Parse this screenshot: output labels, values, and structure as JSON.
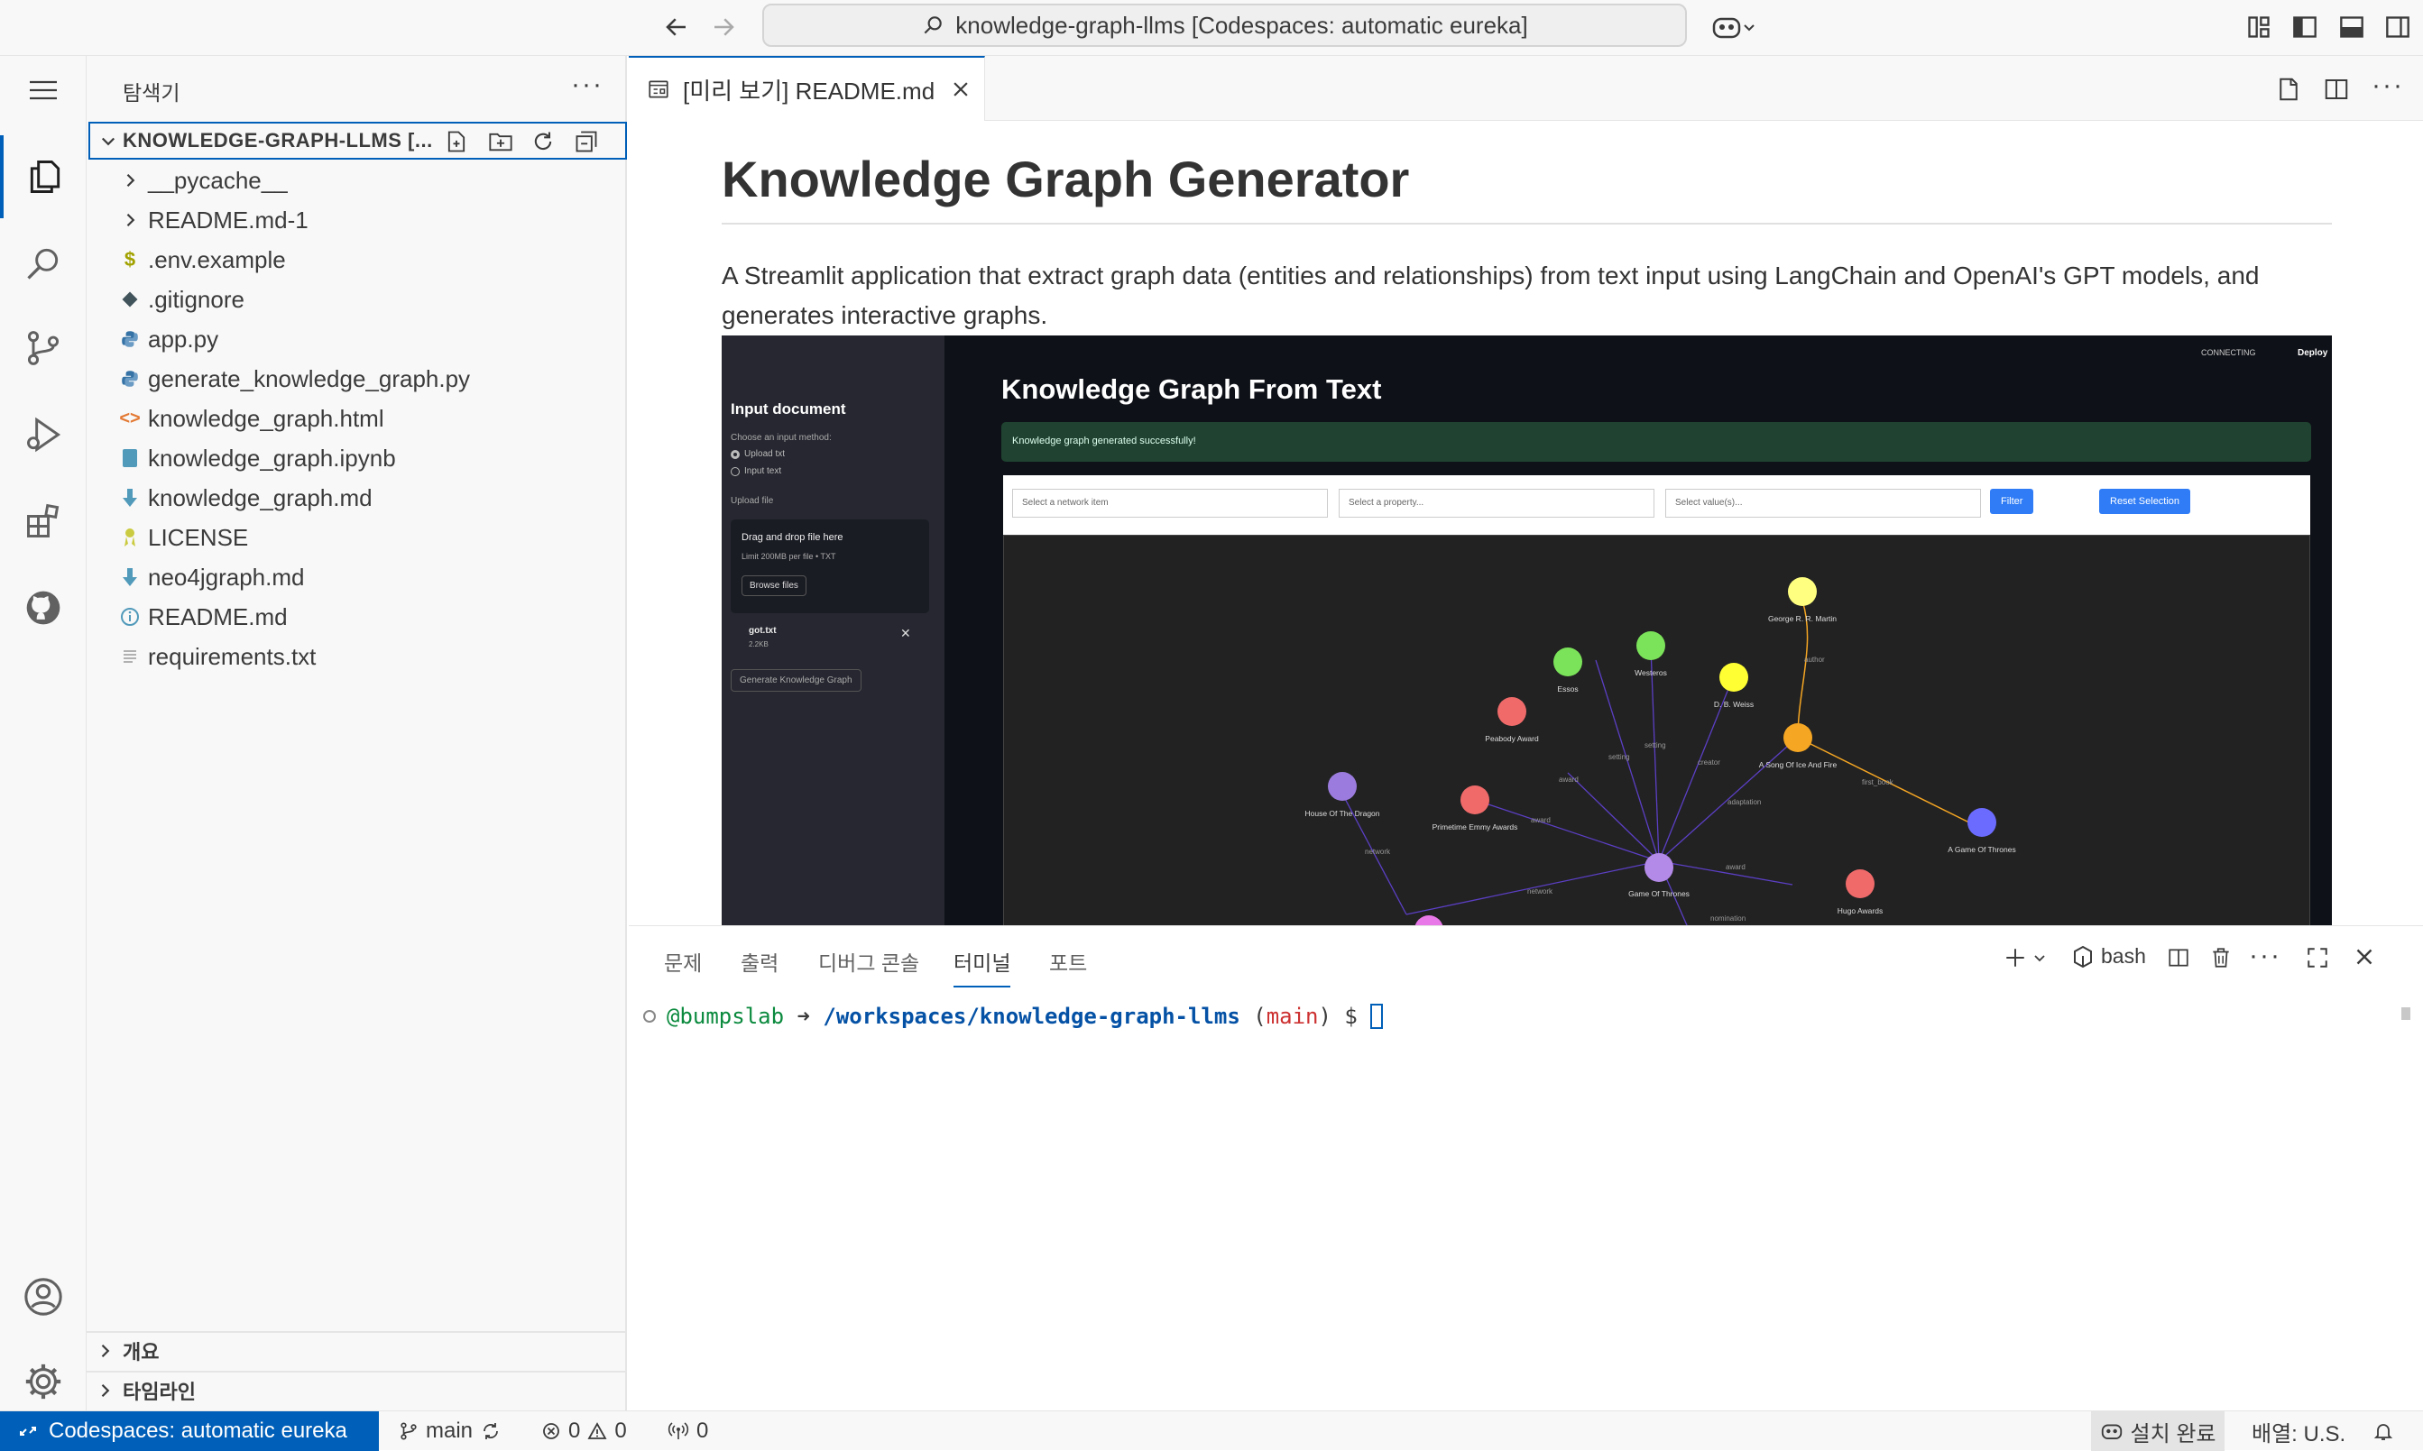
{
  "titlebar": {
    "command_center": "knowledge-graph-llms [Codespaces: automatic eureka]"
  },
  "sidebar": {
    "title": "탐색기",
    "root_label": "KNOWLEDGE-GRAPH-LLMS [...",
    "files": [
      {
        "name": "__pycache__",
        "type": "folder",
        "icon": "chevron-right-icon"
      },
      {
        "name": "README.md-1",
        "type": "folder",
        "icon": "chevron-right-icon"
      },
      {
        "name": ".env.example",
        "type": "file",
        "icon": "dollar-icon"
      },
      {
        "name": ".gitignore",
        "type": "file",
        "icon": "git-icon"
      },
      {
        "name": "app.py",
        "type": "file",
        "icon": "python-icon"
      },
      {
        "name": "generate_knowledge_graph.py",
        "type": "file",
        "icon": "python-icon"
      },
      {
        "name": "knowledge_graph.html",
        "type": "file",
        "icon": "html-icon"
      },
      {
        "name": "knowledge_graph.ipynb",
        "type": "file",
        "icon": "notebook-icon"
      },
      {
        "name": "knowledge_graph.md",
        "type": "file",
        "icon": "markdown-icon"
      },
      {
        "name": "LICENSE",
        "type": "file",
        "icon": "license-icon"
      },
      {
        "name": "neo4jgraph.md",
        "type": "file",
        "icon": "markdown-icon"
      },
      {
        "name": "README.md",
        "type": "file",
        "icon": "info-icon"
      },
      {
        "name": "requirements.txt",
        "type": "file",
        "icon": "text-icon"
      }
    ],
    "sections": [
      "개요",
      "타임라인"
    ]
  },
  "editor": {
    "tab_label": "[미리 보기] README.md",
    "title": "Knowledge Graph Generator",
    "paragraph": "A Streamlit application that extract graph data (entities and relationships) from text input using LangChain and OpenAI's GPT models, and generates interactive graphs.",
    "screenshot": {
      "heading": "Knowledge Graph From Text",
      "status_connecting": "CONNECTING",
      "deploy": "Deploy",
      "success": "Knowledge graph generated successfully!",
      "select_network": "Select a network item",
      "select_property": "Select a property...",
      "select_values": "Select value(s)...",
      "filter": "Filter",
      "reset": "Reset Selection",
      "side_title": "Input document",
      "side_choose": "Choose an input method:",
      "side_opt1": "Upload txt",
      "side_opt2": "Input text",
      "side_upload": "Upload file",
      "side_drag": "Drag and drop file here",
      "side_limit": "Limit 200MB per file • TXT",
      "side_browse": "Browse files",
      "side_file": "got.txt",
      "side_size": "2.2KB",
      "side_generate": "Generate Knowledge Graph",
      "nodes": [
        {
          "label": "George R. R. Martin",
          "color": "#ffff80"
        },
        {
          "label": "Essos",
          "color": "#7be35a"
        },
        {
          "label": "Westeros",
          "color": "#7be35a"
        },
        {
          "label": "D. B. Weiss",
          "color": "#ffff33"
        },
        {
          "label": "Peabody Award",
          "color": "#f06a6a"
        },
        {
          "label": "A Song Of Ice And Fire",
          "color": "#f5a623"
        },
        {
          "label": "House Of The Dragon",
          "color": "#9b7cde"
        },
        {
          "label": "Primetime Emmy Awards",
          "color": "#f06a6a"
        },
        {
          "label": "A Game Of Thrones",
          "color": "#6b6bff"
        },
        {
          "label": "Game Of Thrones",
          "color": "#b48ae8"
        },
        {
          "label": "Hugo Awards",
          "color": "#f06a6a"
        }
      ],
      "edges": [
        "author",
        "first_book",
        "setting",
        "setting",
        "creator",
        "award",
        "adaptation",
        "award",
        "network",
        "award",
        "network",
        "nomination"
      ]
    }
  },
  "panel": {
    "tabs": [
      "문제",
      "출력",
      "디버그 콘솔",
      "터미널",
      "포트"
    ],
    "active_tab": "터미널",
    "shell": "bash",
    "terminal": {
      "user": "@bumpslab",
      "arrow": "➜",
      "path": "/workspaces/knowledge-graph-llms",
      "branch": "main",
      "prompt": "$"
    }
  },
  "statusbar": {
    "remote": "Codespaces: automatic eureka",
    "branch": "main",
    "errors": "0",
    "warnings": "0",
    "ports": "0",
    "install": "설치 완료",
    "layout": "배열: U.S."
  },
  "colors": {
    "accent": "#005fb8",
    "background": "#f8f8f8"
  }
}
